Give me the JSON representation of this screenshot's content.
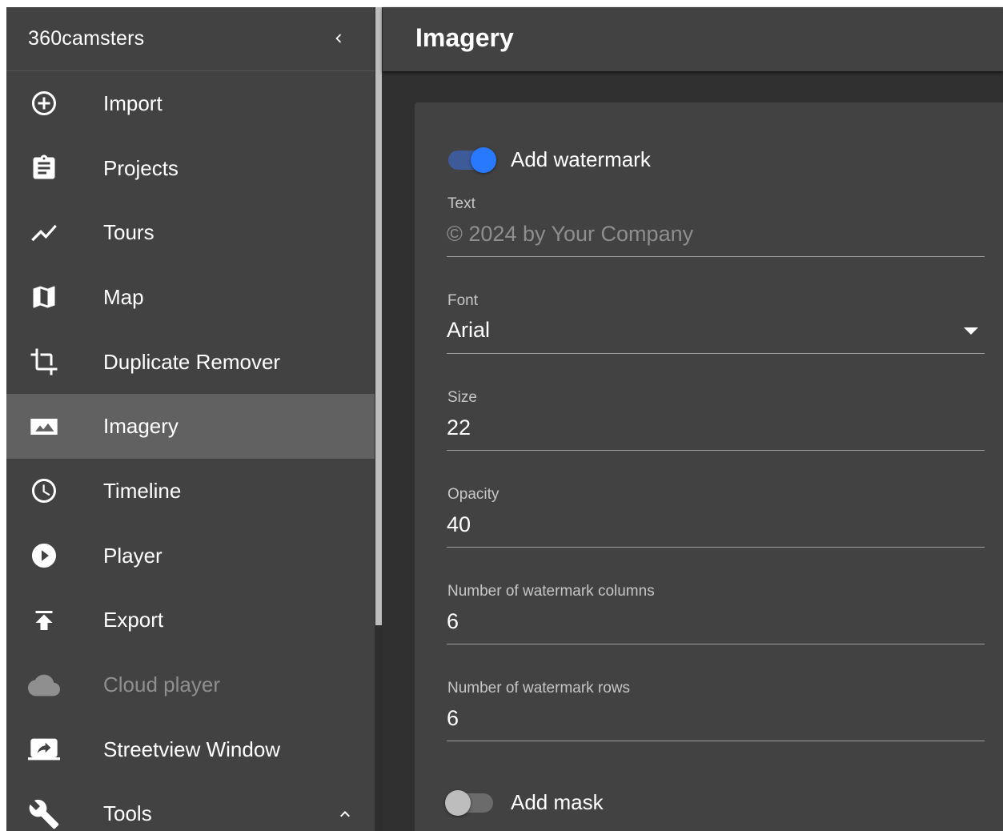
{
  "sidebar": {
    "app_title": "360camsters",
    "items": [
      {
        "label": "Import",
        "icon": "plus-circle-icon"
      },
      {
        "label": "Projects",
        "icon": "clipboard-icon"
      },
      {
        "label": "Tours",
        "icon": "trending-line-icon"
      },
      {
        "label": "Map",
        "icon": "map-icon"
      },
      {
        "label": "Duplicate Remover",
        "icon": "crop-icon"
      },
      {
        "label": "Imagery",
        "icon": "image-icon",
        "active": true
      },
      {
        "label": "Timeline",
        "icon": "clock-icon"
      },
      {
        "label": "Player",
        "icon": "play-circle-icon"
      },
      {
        "label": "Export",
        "icon": "publish-icon"
      },
      {
        "label": "Cloud player",
        "icon": "cloud-icon",
        "disabled": true
      },
      {
        "label": "Streetview Window",
        "icon": "screen-share-icon"
      },
      {
        "label": "Tools",
        "icon": "wrench-icon",
        "expanded": true
      }
    ]
  },
  "header": {
    "title": "Imagery"
  },
  "form": {
    "watermark_toggle": {
      "label": "Add watermark",
      "on": true
    },
    "text_field": {
      "label": "Text",
      "placeholder": "© 2024 by Your Company",
      "value": ""
    },
    "font_field": {
      "label": "Font",
      "value": "Arial"
    },
    "size_field": {
      "label": "Size",
      "value": "22"
    },
    "opacity_field": {
      "label": "Opacity",
      "value": "40"
    },
    "columns_field": {
      "label": "Number of watermark columns",
      "value": "6"
    },
    "rows_field": {
      "label": "Number of watermark rows",
      "value": "6"
    },
    "mask_toggle": {
      "label": "Add mask",
      "on": false
    }
  },
  "colors": {
    "panel": "#424242",
    "background": "#303030",
    "active_item": "#616161",
    "accent": "#2979ff",
    "switch_track_on": "#3d5a99",
    "switch_off_thumb": "#bdbdbd",
    "switch_off_track": "#6b6b6b"
  }
}
